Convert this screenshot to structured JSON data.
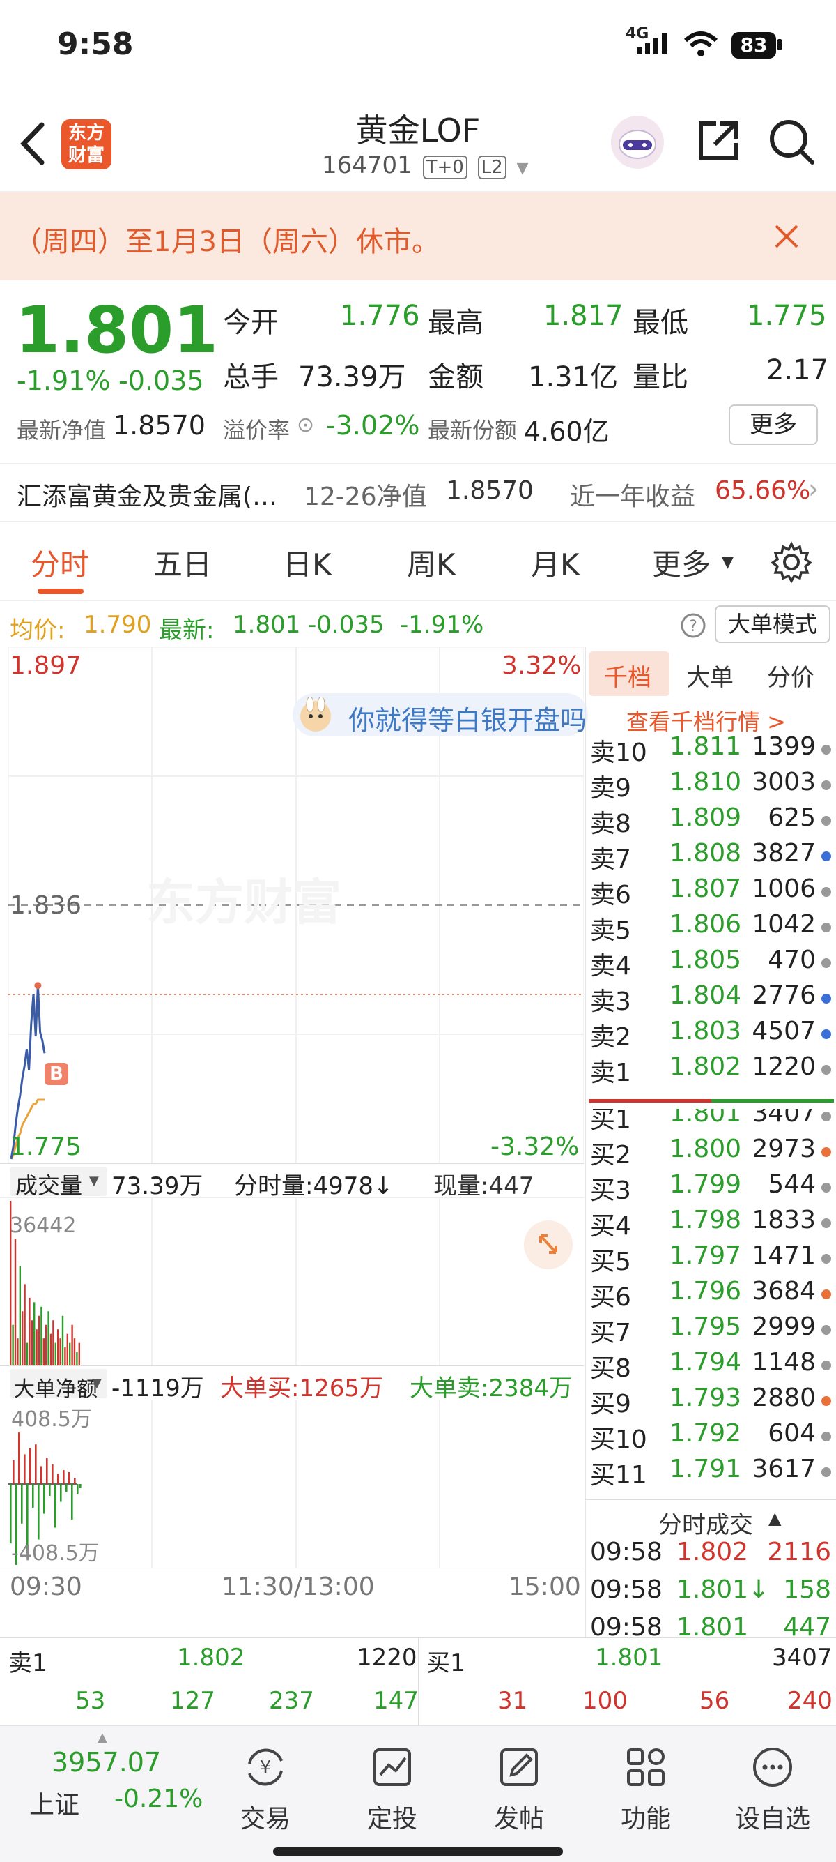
{
  "status": {
    "time": "9:58",
    "network": "4G",
    "battery": "83"
  },
  "header": {
    "logo_line1": "东方",
    "logo_line2": "财富",
    "title": "黄金LOF",
    "code": "164701",
    "badge1": "T+0",
    "badge2": "L2"
  },
  "notice": {
    "text": "（周四）至1月3日（周六）休市。"
  },
  "quote": {
    "price": "1.801",
    "change_pct": "-1.91%",
    "change": "-0.035",
    "open_label": "今开",
    "open": "1.776",
    "high_label": "最高",
    "high": "1.817",
    "low_label": "最低",
    "low": "1.775",
    "vol_label": "总手",
    "vol": "73.39万",
    "amt_label": "金额",
    "amt": "1.31亿",
    "ratio_label": "量比",
    "ratio": "2.17",
    "nav_label": "最新净值",
    "nav": "1.8570",
    "prem_label": "溢价率",
    "prem": "-3.02%",
    "share_label": "最新份额",
    "share": "4.60亿",
    "more": "更多"
  },
  "fund": {
    "name": "汇添富黄金及贵金属(…",
    "date": "12-26净值",
    "nav": "1.8570",
    "yr_label": "近一年收益",
    "yr": "65.66%"
  },
  "tabs": [
    "分时",
    "五日",
    "日K",
    "周K",
    "月K",
    "更多"
  ],
  "avgbar": {
    "avg_label": "均价:",
    "avg": "1.790",
    "new_label": "最新:",
    "new": "1.801",
    "chg": "-0.035",
    "pct": "-1.91%",
    "mode": "大单模式"
  },
  "chart": {
    "top_price": "1.897",
    "top_pct": "3.32%",
    "mid_price": "1.836",
    "bot_price": "1.775",
    "bot_pct": "-3.32%",
    "ad": "你就得等白银开盘吗",
    "watermark": "东方财富",
    "vol_label": "成交量",
    "vol_total": "73.39万",
    "min_vol": "分时量:4978↓",
    "now_vol": "现量:447",
    "vol_max": "36442",
    "flow_label": "大单净额",
    "flow": "-1119万",
    "big_buy": "大单买:1265万",
    "big_sell": "大单卖:2384万",
    "flow_max": "408.5万",
    "flow_min": "-408.5万",
    "t1": "09:30",
    "t2": "11:30/13:00",
    "t3": "15:00"
  },
  "chart_data": {
    "type": "line",
    "series": [
      {
        "values": [
          1.776,
          1.779,
          1.784,
          1.788,
          1.791,
          1.795,
          1.798,
          1.802,
          1.797,
          1.808,
          1.815,
          1.805,
          1.817,
          1.806,
          1.804,
          1.801
        ]
      }
    ],
    "avg": [
      1.776,
      1.777,
      1.779,
      1.781,
      1.782,
      1.784,
      1.785,
      1.786,
      1.787,
      1.788,
      1.789,
      1.789,
      1.79,
      1.79,
      1.79,
      1.79
    ],
    "ylim": [
      1.775,
      1.897
    ],
    "mid": 1.836,
    "volume": [
      36442,
      9000,
      28000,
      6000,
      22000,
      12000,
      18000,
      5000,
      15000,
      10000,
      14000,
      8000,
      11000,
      13000,
      6000,
      9000,
      12000,
      7000,
      10000,
      5000,
      8000,
      6000,
      11000,
      4000,
      7000,
      5000,
      9000,
      6000,
      3000,
      4978
    ],
    "flow": [
      -300,
      120,
      -408,
      260,
      -200,
      150,
      -350,
      180,
      -120,
      200,
      -280,
      90,
      -150,
      130,
      -60,
      100,
      -220,
      50,
      -90,
      70,
      -40,
      60,
      -180,
      30,
      -50,
      -20
    ]
  },
  "book": {
    "tabs": [
      "千档",
      "大单",
      "分价"
    ],
    "link": "查看千档行情 >",
    "asks": [
      {
        "l": "卖10",
        "p": "1.811",
        "v": "1399",
        "c": "#999"
      },
      {
        "l": "卖9",
        "p": "1.810",
        "v": "3003",
        "c": "#999"
      },
      {
        "l": "卖8",
        "p": "1.809",
        "v": "625",
        "c": "#999"
      },
      {
        "l": "卖7",
        "p": "1.808",
        "v": "3827",
        "c": "#3a6fd8"
      },
      {
        "l": "卖6",
        "p": "1.807",
        "v": "1006",
        "c": "#999"
      },
      {
        "l": "卖5",
        "p": "1.806",
        "v": "1042",
        "c": "#999"
      },
      {
        "l": "卖4",
        "p": "1.805",
        "v": "470",
        "c": "#999"
      },
      {
        "l": "卖3",
        "p": "1.804",
        "v": "2776",
        "c": "#3a6fd8"
      },
      {
        "l": "卖2",
        "p": "1.803",
        "v": "4507",
        "c": "#3a6fd8"
      },
      {
        "l": "卖1",
        "p": "1.802",
        "v": "1220",
        "c": "#999"
      }
    ],
    "bids": [
      {
        "l": "买1",
        "p": "1.801",
        "v": "3407",
        "c": "#999"
      },
      {
        "l": "买2",
        "p": "1.800",
        "v": "2973",
        "c": "#e8713b"
      },
      {
        "l": "买3",
        "p": "1.799",
        "v": "544",
        "c": "#999"
      },
      {
        "l": "买4",
        "p": "1.798",
        "v": "1833",
        "c": "#999"
      },
      {
        "l": "买5",
        "p": "1.797",
        "v": "1471",
        "c": "#999"
      },
      {
        "l": "买6",
        "p": "1.796",
        "v": "3684",
        "c": "#e8713b"
      },
      {
        "l": "买7",
        "p": "1.795",
        "v": "2999",
        "c": "#999"
      },
      {
        "l": "买8",
        "p": "1.794",
        "v": "1148",
        "c": "#999"
      },
      {
        "l": "买9",
        "p": "1.793",
        "v": "2880",
        "c": "#e8713b"
      },
      {
        "l": "买10",
        "p": "1.792",
        "v": "604",
        "c": "#999"
      },
      {
        "l": "买11",
        "p": "1.791",
        "v": "3617",
        "c": "#999"
      }
    ],
    "trades_title": "分时成交",
    "trades": [
      {
        "t": "09:58",
        "p": "1.802",
        "v": "2116",
        "pc": "red",
        "vc": "red"
      },
      {
        "t": "09:58",
        "p": "1.801↓",
        "v": "158",
        "pc": "green",
        "vc": "green"
      },
      {
        "t": "09:58",
        "p": "1.801",
        "v": "447",
        "pc": "green",
        "vc": "green"
      }
    ]
  },
  "bottom": {
    "sell1_label": "卖1",
    "sell1_p": "1.802",
    "sell1_v": "1220",
    "buy1_label": "买1",
    "buy1_p": "1.801",
    "buy1_v": "3407",
    "left_nums": [
      "53",
      "127",
      "237",
      "147"
    ],
    "right_nums": [
      "31",
      "100",
      "56",
      "240"
    ]
  },
  "nav": {
    "index_val": "3957.07",
    "index_name": "上证",
    "index_pct": "-0.21%",
    "items": [
      "交易",
      "定投",
      "发帖",
      "功能",
      "设自选"
    ]
  }
}
